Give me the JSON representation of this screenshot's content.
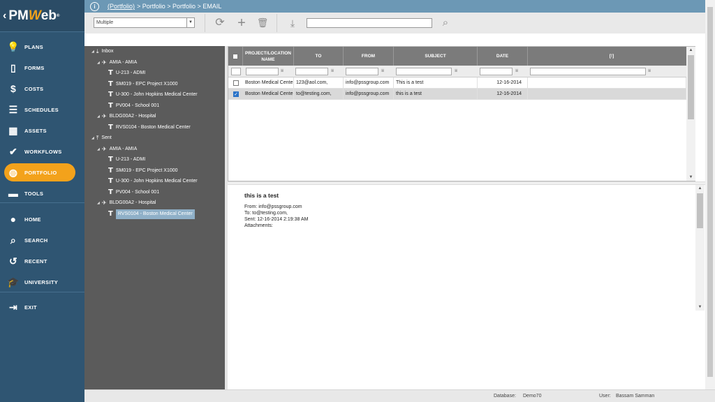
{
  "logo": {
    "prefix": "PM",
    "accent": "W",
    "suffix": "eb",
    "reg": "®"
  },
  "sidebar": {
    "items": [
      {
        "label": "PLANS",
        "icon": "lightbulb-icon",
        "glyph": "💡"
      },
      {
        "label": "FORMS",
        "icon": "document-icon",
        "glyph": "▯"
      },
      {
        "label": "COSTS",
        "icon": "dollar-icon",
        "glyph": "$"
      },
      {
        "label": "SCHEDULES",
        "icon": "schedule-icon",
        "glyph": "☰"
      },
      {
        "label": "ASSETS",
        "icon": "building-icon",
        "glyph": "▦"
      },
      {
        "label": "WORKFLOWS",
        "icon": "check-icon",
        "glyph": "✔"
      },
      {
        "label": "PORTFOLIO",
        "icon": "globe-icon",
        "glyph": "◍"
      },
      {
        "label": "TOOLS",
        "icon": "toolbox-icon",
        "glyph": "▬"
      },
      {
        "label": "HOME",
        "icon": "avatar-icon",
        "glyph": "●"
      },
      {
        "label": "SEARCH",
        "icon": "search-icon",
        "glyph": "⌕"
      },
      {
        "label": "RECENT",
        "icon": "history-icon",
        "glyph": "↺"
      },
      {
        "label": "UNIVERSITY",
        "icon": "graduation-cap-icon",
        "glyph": "🎓"
      },
      {
        "label": "EXIT",
        "icon": "exit-icon",
        "glyph": "⇥"
      }
    ],
    "active": "PORTFOLIO"
  },
  "breadcrumb": {
    "link": "(Portfolio)",
    "rest": "> Portfolio > Portfolio > EMAIL"
  },
  "toolbar": {
    "selector_value": "Multiple",
    "search_value": ""
  },
  "tree": {
    "nodes": [
      {
        "label": "Inbox",
        "kind": "folder-in",
        "level": 0
      },
      {
        "label": "AMIA - AMIA",
        "kind": "program",
        "level": 1
      },
      {
        "label": "U-213 - ADMI",
        "kind": "project",
        "level": 2
      },
      {
        "label": "SM019 - EPC Project X1000",
        "kind": "project",
        "level": 2
      },
      {
        "label": "U-300 - John Hopkins Medical Center",
        "kind": "project",
        "level": 2
      },
      {
        "label": "PV004 - School 001",
        "kind": "project",
        "level": 2
      },
      {
        "label": "BLDG00A2 - Hospital",
        "kind": "program",
        "level": 1
      },
      {
        "label": "RVS0104 - Boston Medical Center",
        "kind": "project",
        "level": 2
      },
      {
        "label": "Sent",
        "kind": "folder-out",
        "level": 0
      },
      {
        "label": "AMIA - AMIA",
        "kind": "program",
        "level": 1
      },
      {
        "label": "U-213 - ADMI",
        "kind": "project",
        "level": 2
      },
      {
        "label": "SM019 - EPC Project X1000",
        "kind": "project",
        "level": 2
      },
      {
        "label": "U-300 - John Hopkins Medical Center",
        "kind": "project",
        "level": 2
      },
      {
        "label": "PV004 - School 001",
        "kind": "project",
        "level": 2
      },
      {
        "label": "BLDG00A2 - Hospital",
        "kind": "program",
        "level": 1
      },
      {
        "label": "RVS0104 - Boston Medical Center",
        "kind": "project",
        "level": 2,
        "selected": true
      }
    ]
  },
  "grid": {
    "columns": [
      "PROJECT/LOCATION NAME",
      "TO",
      "FROM",
      "SUBJECT",
      "DATE",
      "[!]"
    ],
    "rows": [
      {
        "checked": false,
        "project": "Boston Medical Center",
        "to": "123@aol.com,",
        "from": "info@pssgroup.com",
        "subject": "This is a test",
        "date": "12-16-2014"
      },
      {
        "checked": true,
        "project": "Boston Medical Center",
        "to": "to@testing.com,",
        "from": "info@pssgroup.com",
        "subject": "this is a test",
        "date": "12-16-2014"
      }
    ]
  },
  "preview": {
    "subject": "this is a test",
    "from": "From: info@pssgroup.com",
    "to": "To: to@testing.com,",
    "sent": "Sent: 12-16-2014 2:19:38 AM",
    "attachments": "Attachments:"
  },
  "status": {
    "database_label": "Database:",
    "database_value": "Demo70",
    "user_label": "User:",
    "user_value": "Bassam Samman"
  },
  "colors": {
    "sidebar": "#2f5572",
    "accent": "#f3a21b",
    "topbar": "#6c98b5",
    "tree": "#5b5b5b"
  }
}
